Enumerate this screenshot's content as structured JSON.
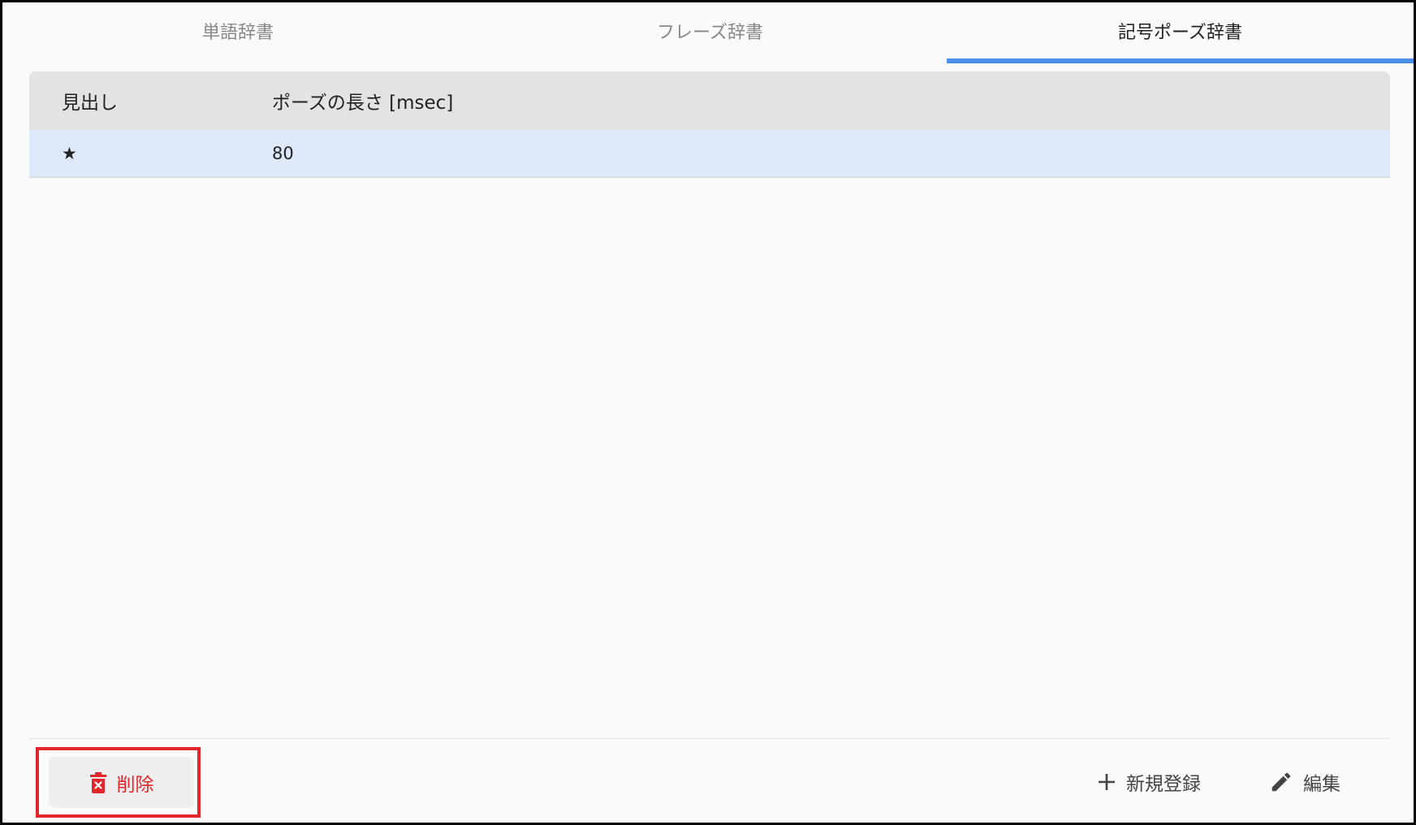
{
  "tabs": [
    {
      "label": "単語辞書",
      "active": false
    },
    {
      "label": "フレーズ辞書",
      "active": false
    },
    {
      "label": "記号ポーズ辞書",
      "active": true
    }
  ],
  "table": {
    "columns": [
      "見出し",
      "ポーズの長さ [msec]"
    ],
    "rows": [
      {
        "symbol": "★",
        "pause": "80",
        "selected": true
      }
    ]
  },
  "footer": {
    "delete_label": "削除",
    "add_label": "新規登録",
    "edit_label": "編集"
  },
  "icons": {
    "delete": "trash-icon",
    "add": "plus-icon",
    "edit": "pencil-icon"
  },
  "colors": {
    "accent": "#4c8fe6",
    "danger": "#e3262c",
    "selected_row": "#dde9f9",
    "header_bg": "#e3e3e3"
  }
}
